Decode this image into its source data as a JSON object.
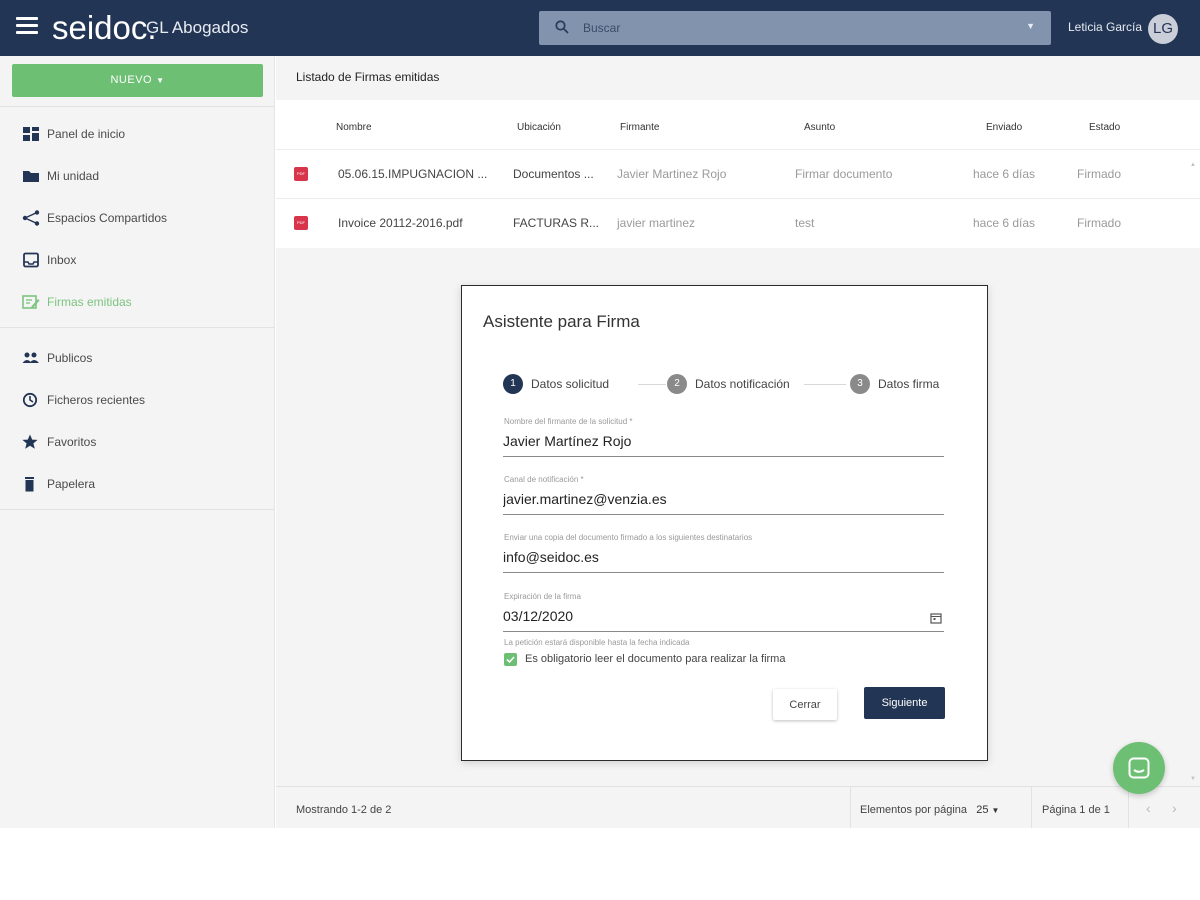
{
  "header": {
    "brand": "seidoc.",
    "org": "GL Abogados",
    "search_placeholder": "Buscar",
    "user_name": "Leticia García",
    "user_initials": "LG"
  },
  "sidebar": {
    "new_label": "NUEVO",
    "items": [
      {
        "label": "Panel de inicio",
        "icon": "dashboard-icon"
      },
      {
        "label": "Mi unidad",
        "icon": "folder-icon"
      },
      {
        "label": "Espacios Compartidos",
        "icon": "share-icon"
      },
      {
        "label": "Inbox",
        "icon": "inbox-icon"
      },
      {
        "label": "Firmas emitidas",
        "icon": "signature-icon",
        "active": true
      },
      {
        "label": "Publicos",
        "icon": "people-icon"
      },
      {
        "label": "Ficheros recientes",
        "icon": "clock-icon"
      },
      {
        "label": "Favoritos",
        "icon": "star-icon"
      },
      {
        "label": "Papelera",
        "icon": "trash-icon"
      }
    ],
    "active_color": "#7cc47f"
  },
  "main": {
    "title": "Listado de Firmas emitidas",
    "columns": [
      "Nombre",
      "Ubicación",
      "Firmante",
      "Asunto",
      "Enviado",
      "Estado"
    ],
    "rows": [
      {
        "nombre": "05.06.15.IMPUGNACION ...",
        "ubicacion": "Documentos ...",
        "firmante": "Javier Martinez Rojo",
        "asunto": "Firmar documento",
        "enviado": "hace 6 días",
        "estado": "Firmado"
      },
      {
        "nombre": "Invoice 20112-2016.pdf",
        "ubicacion": "FACTURAS R...",
        "firmante": "javier martinez",
        "asunto": "test",
        "enviado": "hace 6 días",
        "estado": "Firmado"
      }
    ],
    "file_badge": "PDF",
    "footer": {
      "count": "Mostrando 1-2 de 2",
      "per_page_label": "Elementos por página",
      "per_page_value": "25",
      "page_info": "Página 1 de 1"
    }
  },
  "dialog": {
    "title": "Asistente para Firma",
    "steps": [
      {
        "num": "1",
        "label": "Datos solicitud"
      },
      {
        "num": "2",
        "label": "Datos notificación"
      },
      {
        "num": "3",
        "label": "Datos firma"
      }
    ],
    "fields": [
      {
        "label": "Nombre del firmante de la solicitud *",
        "value": "Javier Martínez Rojo"
      },
      {
        "label": "Canal de notificación *",
        "value": "javier.martinez@venzia.es"
      },
      {
        "label": "Enviar una copia del documento firmado a los siguientes destinatarios",
        "value": "info@seidoc.es"
      },
      {
        "label": "Expiración de la firma",
        "value": "03/12/2020"
      }
    ],
    "hint": "La petición estará disponible hasta la fecha indicada",
    "checkbox_label": "Es obligatorio leer el documento para realizar la firma",
    "checkbox_checked": true,
    "close_label": "Cerrar",
    "next_label": "Siguiente"
  },
  "colors": {
    "header_bg": "#233554",
    "accent_green": "#6dbf73",
    "pdf_red": "#d8344a",
    "primary_button": "#233554"
  }
}
